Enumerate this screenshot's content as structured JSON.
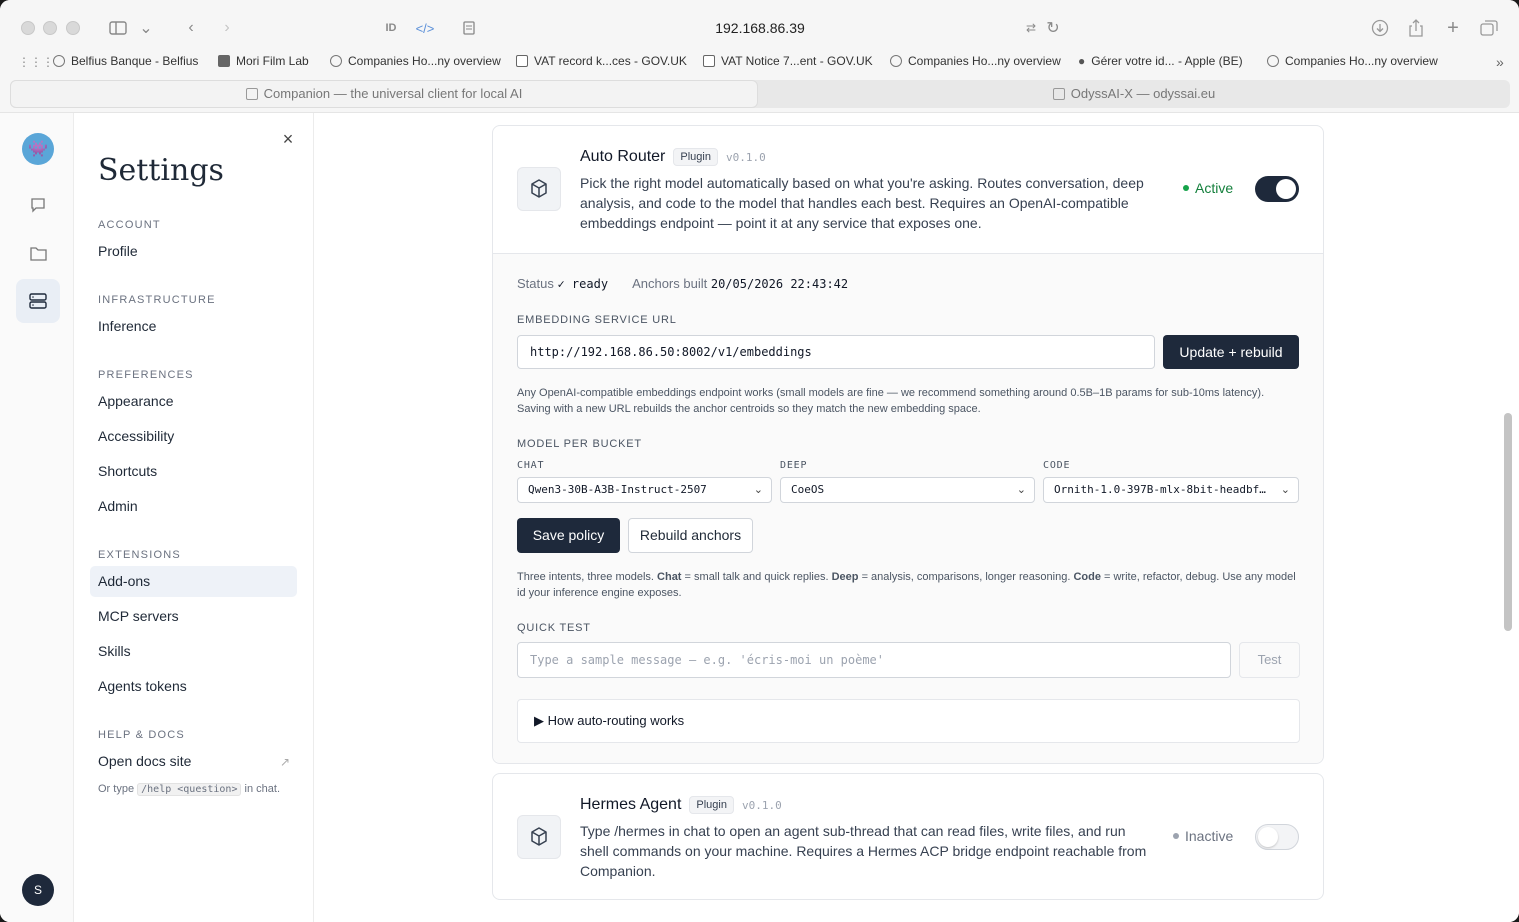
{
  "browser": {
    "address": "192.168.86.39",
    "bookmarks": [
      "Belfius Banque - Belfius",
      "Mori Film Lab",
      "Companies Ho...ny overview",
      "VAT record k...ces - GOV.UK",
      "VAT Notice 7...ent - GOV.UK",
      "Companies Ho...ny overview",
      "Gérer votre id... - Apple (BE)",
      "Companies Ho...ny overview"
    ],
    "tabs": [
      "Companion — the universal client for local AI",
      "OdyssAI-X — odyssai.eu"
    ]
  },
  "rail": {
    "logo_icon": "space-invader-icon",
    "items": [
      "chat-bubble-icon",
      "folder-icon",
      "server-icon"
    ],
    "avatar_initial": "S"
  },
  "settings": {
    "title": "Settings",
    "sections": [
      {
        "label": "ACCOUNT",
        "items": [
          "Profile"
        ]
      },
      {
        "label": "INFRASTRUCTURE",
        "items": [
          "Inference"
        ]
      },
      {
        "label": "PREFERENCES",
        "items": [
          "Appearance",
          "Accessibility",
          "Shortcuts",
          "Admin"
        ]
      },
      {
        "label": "EXTENSIONS",
        "items": [
          "Add-ons",
          "MCP servers",
          "Skills",
          "Agents tokens"
        ]
      },
      {
        "label": "HELP & DOCS",
        "items": [
          "Open docs site"
        ]
      }
    ],
    "active_item": "Add-ons",
    "docs_hint_prefix": "Or type",
    "docs_hint_code": "/help <question>",
    "docs_hint_suffix": "in chat."
  },
  "auto_router": {
    "name": "Auto Router",
    "badge": "Plugin",
    "version": "v0.1.0",
    "description": "Pick the right model automatically based on what you're asking. Routes conversation, deep analysis, and code to the model that handles each best. Requires an OpenAI-compatible embeddings endpoint — point it at any service that exposes one.",
    "status_text": "Active",
    "status_color": "#16a34a",
    "enabled": true,
    "status_label": "Status",
    "status_value": "✓ ready",
    "anchors_label": "Anchors built",
    "anchors_value": "20/05/2026 22:43:42",
    "embedding_label": "EMBEDDING SERVICE URL",
    "embedding_url": "http://192.168.86.50:8002/v1/embeddings",
    "update_button": "Update + rebuild",
    "embedding_help": "Any OpenAI-compatible embeddings endpoint works (small models are fine — we recommend something around 0.5B–1B params for sub-10ms latency). Saving with a new URL rebuilds the anchor centroids so they match the new embedding space.",
    "bucket_label": "MODEL PER BUCKET",
    "buckets": [
      {
        "label": "CHAT",
        "value": "Qwen3-30B-A3B-Instruct-2507"
      },
      {
        "label": "DEEP",
        "value": "CoeOS"
      },
      {
        "label": "CODE",
        "value": "Ornith-1.0-397B-mlx-8bit-headbf…"
      }
    ],
    "save_button": "Save policy",
    "rebuild_button": "Rebuild anchors",
    "intents_text_1": "Three intents, three models.",
    "intents_bold_chat": "Chat",
    "intents_text_2": "= small talk and quick replies.",
    "intents_bold_deep": "Deep",
    "intents_text_3": "= analysis, comparisons, longer reasoning.",
    "intents_bold_code": "Code",
    "intents_text_4": "= write, refactor, debug. Use any model id your inference engine exposes.",
    "quick_test_label": "QUICK TEST",
    "quick_test_placeholder": "Type a sample message — e.g. 'écris-moi un poème'",
    "test_button": "Test",
    "details_summary": "▶ How auto-routing works"
  },
  "hermes": {
    "name": "Hermes Agent",
    "badge": "Plugin",
    "version": "v0.1.0",
    "description": "Type /hermes in chat to open an agent sub-thread that can read files, write files, and run shell commands on your machine. Requires a Hermes ACP bridge endpoint reachable from Companion.",
    "status_text": "Inactive",
    "status_color": "#9ca3af",
    "enabled": false
  }
}
